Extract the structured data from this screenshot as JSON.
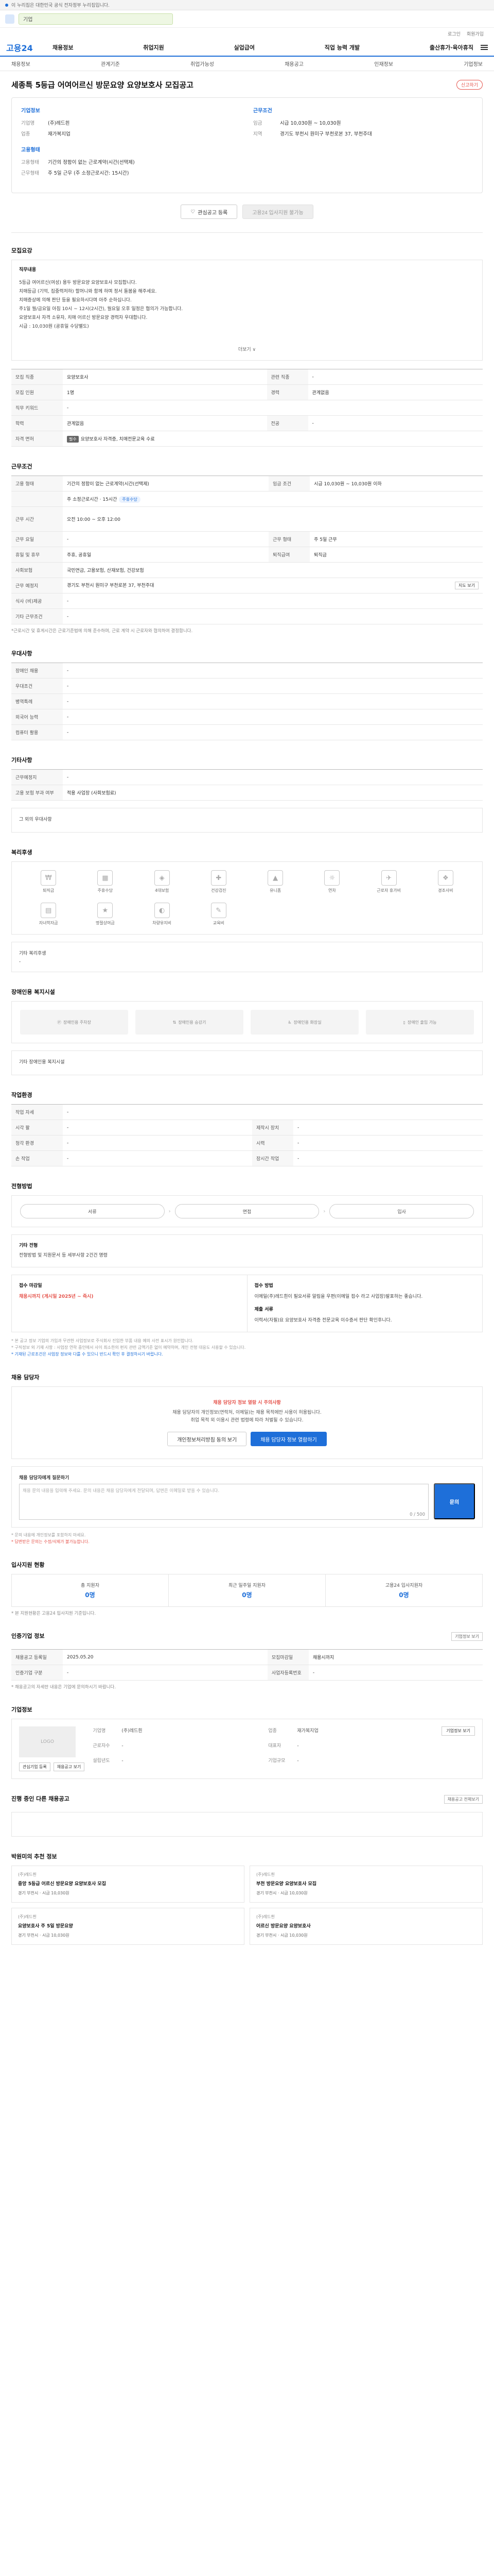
{
  "topbar": {
    "notice": "이 누리집은 대한민국 공식 전자정부 누리집입니다."
  },
  "search": {
    "value": "기업"
  },
  "util": {
    "links": [
      "로그인",
      "회원가입"
    ]
  },
  "gnb": {
    "logo": "고용24",
    "items": [
      "채용정보",
      "취업지원",
      "실업급여",
      "직업 능력 개발",
      "출산휴가·육아휴직"
    ]
  },
  "snb": {
    "items": [
      "채용정보",
      "관계기준",
      "취업가능성",
      "채용공고",
      "인재정보",
      "기업정보"
    ]
  },
  "job": {
    "title": "세종특 5등급 어여어르신 방문요양 요양보호사 모집공고",
    "report_label": "신고하기",
    "company_heading": "기업정보",
    "company": [
      {
        "k": "기업명",
        "v": "(주)레드흰"
      },
      {
        "k": "업종",
        "v": "재가복지업"
      }
    ],
    "manager_heading": "고용형태",
    "manager": [
      {
        "k": "고용형태",
        "v": "기간의 정함이 없는 근로계약(시간(선택제)"
      },
      {
        "k": "근무형태",
        "v": "주 5일 근무 (주 소정근로시간: 15시간)"
      }
    ],
    "cond_heading": "근무조건",
    "cond": [
      {
        "k": "임금",
        "v": "시급 10,030원 ~ 10,030원"
      },
      {
        "k": "지역",
        "v": "경기도 부천시 원미구 부천로본 37, 부천주대"
      }
    ],
    "btn_scrap": "관심공고 등록",
    "btn_apply": "고용24 입사지원 불가능"
  },
  "sections": {
    "recruit": "모집요강",
    "condition": "근무조건",
    "preference": "우대사항",
    "other": "기타사항",
    "welfare": "복리후생",
    "disabled": "장애인용 복지시설",
    "workplace": "작업환경",
    "process": "전형방법",
    "manager": "채용 담당자",
    "status": "입사지원 현황",
    "jobinfo": "인증기업 정보",
    "company": "기업정보",
    "recent": "진행 중인 다른 채용공고",
    "recommend": "박원미의 추천 정보"
  },
  "recruit": {
    "sub": "직무내용",
    "lines": [
      "5등급 여어르신(여성) 용두 방문요양 요양보호사 모집합니다.",
      "치매등급 (기억, 집중력저하) 할머니와 함께 하며 정서 돌봄을 해주세요.",
      "치매증상에 의해 판단 등을 필요하시다며 아주 순하십니다.",
      "주1일 월/금요일 아침 10시 ~ 12시(2시간), 월요일 오후 일정은 협의가 가능합니다.",
      "요양보호사 자격 소유자, 치매 어르신 방문요양 경력자 우대합니다.",
      "시급 : 10,030원 (공휴일 수당별도)"
    ],
    "more": "더보기 ∨"
  },
  "recruit_table": [
    {
      "k1": "모집 직종",
      "v1": "요양보호사",
      "k2": "관련 직종",
      "v2": "-"
    },
    {
      "k1": "모집 인원",
      "v1": "1명",
      "k2": "경력",
      "v2": "관계없음"
    },
    {
      "k1": "직무 키워드",
      "v1": "-",
      "k2": "",
      "v2": ""
    },
    {
      "k1": "학력",
      "v1": "관계없음",
      "k2": "전공",
      "v2": "-"
    },
    {
      "k1": "자격 면허",
      "v1": "요양보호사 자격증, 치매전문교육 수료",
      "k2": "",
      "v2": ""
    }
  ],
  "condition_table": {
    "employ_type": "기간의 정함이 없는 근로계약(시간(선택제)",
    "wage": "시급 10,030원 ~ 10,030원 이하",
    "wage_tag": "주휴수당",
    "wage_note": "주 소정근로시간 · 15시간",
    "time": "오전 10:00 ~ 오후 12:00",
    "workdays": "주 5일 근무",
    "holiday": "주휴, 공휴일",
    "insurance": "국민연금, 고용보험, 산재보험, 건강보험",
    "retire": "퇴직금",
    "location": "경기도 부천시 원미구 부천로본 37, 부천주대",
    "map_btn": "지도 보기",
    "meal": "-",
    "notice": "*근로시간 및 휴게시간은 근로기준법에 의해 준수하며, 근로 계약 시 근로자와 협의하여 결정합니다."
  },
  "condition_labels": [
    "고용 형태",
    "임금 조건",
    "근무 시간",
    "근무 요일",
    "휴일 및 휴무",
    "사회보험",
    "퇴직급여",
    "근무 예정지",
    "식사 (비)제공",
    "기타 근무조건"
  ],
  "preference_labels": [
    "장애인 채용",
    "우대조건",
    "병역특례",
    "외국어 능력",
    "컴퓨터 활용"
  ],
  "preference_values": [
    "-",
    "-",
    "-",
    "-",
    "-"
  ],
  "other_table": [
    {
      "k": "근무예정지",
      "v": "-"
    },
    {
      "k": "고용 보험 부과 여부",
      "v": "적용 사업장 (사회보험료)"
    }
  ],
  "other_extra": "그 외의 우대사항",
  "welfare_icons": [
    "퇴직금",
    "주휴수당",
    "4대보험",
    "건강검진",
    "유니폼",
    "연차",
    "근로자 휴가비",
    "경조사비",
    "자녀학자금",
    "명절상여금",
    "차량유지비",
    "교육비"
  ],
  "welfare_extra": "기타 복리후생",
  "welfare_extra_value": "-",
  "disabled_items": [
    "장애인용 주차장",
    "장애인용 승강기",
    "장애인용 화장실",
    "장애인 출입 가능"
  ],
  "disabled_extra": "기타 장애인용 복지시설",
  "workplace_table": [
    {
      "k1": "작업 자세",
      "v1": "-",
      "k2": "",
      "v2": ""
    },
    {
      "k1": "시각 팔",
      "v1": "-",
      "k2": "제작시 장치",
      "v2": "-"
    },
    {
      "k1": "청각 환경",
      "v1": "-",
      "k2": "시력",
      "v2": "-"
    },
    {
      "k1": "손 작업",
      "v1": "-",
      "k2": "장시간 작업",
      "v2": "-"
    }
  ],
  "process_steps": [
    "서류",
    "면접",
    "입사"
  ],
  "process_sub": "기타 전형",
  "process_note": "전형방법 및 지원문서 등 세부사항 2건건 명령",
  "apply": {
    "deadline_lbl": "접수 마감일",
    "deadline": "채용시까지 (게시일 2025년 ~ 즉시)",
    "method_lbl": "접수 방법",
    "method": "이메일(주)레드흰이 필요서류 알림을 우편(이메일 접수 라고 사업장)발표하는 좋습니다.",
    "doc_lbl": "제출 서류",
    "doc": "이력서(자필)요 요양보호사 자격증 전문교육 이수증서 판단 확인후니다."
  },
  "apply_notes": [
    "* 본 공고 정보 기업의 가입과 무관한 사업정보로 주식회사 진입한 부품 내용 예의 사전 표시가 원인합니다.",
    "* 구직정보 외 기재 사항 : 사업장 연락 중인에서 사이 최소한의 편지 관련 금액기준 없이 예약하며, 개인 전형 대응도 사용할 수 있습니다.",
    "* 기재된 근로조건은 사업장 정보와 다를 수 있으니 반드시 확인 후 결정하시기 바랍니다."
  ],
  "manager": {
    "title": "채용 담당자 정보 열람 시 주의사항",
    "desc1": "채용 담당자의 개인정보(연락처, 이메일)는 채용 목적에만 사용이 허용됩니다.",
    "desc2": "취업 목적 외 이용시 관련 법령에 따라 처벌될 수 있습니다.",
    "btn1": "개인정보처리방침 동의 보기",
    "btn2": "채용 담당자 정보 열람하기"
  },
  "inquiry": {
    "label": "채용 담당자에게 질문하기",
    "placeholder": "채용 문의 내용을 입력해 주세요. 문의 내용은 채용 담당자에게 전달되며, 답변은 이메일로 받을 수 있습니다.",
    "count": "0 / 500",
    "btn": "문의",
    "notes": [
      "* 문의 내용에 개인정보를 포함하지 마세요.",
      "* 답변받은 문의는 수정/삭제가 불가능합니다."
    ]
  },
  "status": [
    {
      "lbl": "총 지원자",
      "num": "0명"
    },
    {
      "lbl": "최근 일주일 지원자",
      "num": "0명"
    },
    {
      "lbl": "고용24 입사지원자",
      "num": "0명"
    }
  ],
  "status_note": "* 본 지원현황은 고용24 입사지원 기준입니다.",
  "jobinfo_btn": "기업정보 보기",
  "jobinfo_rows": [
    {
      "k1": "채용공고 등록일",
      "v1": "2025.05.20",
      "k2": "모집마감일",
      "v2": "채용시까지"
    },
    {
      "k1": "인증기업 구분",
      "v1": "-",
      "k2": "사업자등록번호",
      "v2": "-"
    }
  ],
  "jobinfo_note": "* 채용공고의 자세한 내용은 기업에 문의하시기 바랍니다.",
  "company": {
    "logo": "LOGO",
    "rows": [
      {
        "k": "기업명",
        "v": "(주)레드흰"
      },
      {
        "k": "업종",
        "v": "재가복지업"
      },
      {
        "k": "근로자수",
        "v": "-"
      },
      {
        "k": "대표자",
        "v": "-"
      },
      {
        "k": "설립년도",
        "v": "-"
      },
      {
        "k": "기업규모",
        "v": "-"
      }
    ],
    "btn": "기업정보 보기",
    "small": [
      "관심기업 등록",
      "채용공고 보기"
    ]
  },
  "recent_link": "채용공고 전체보기",
  "recommend": [
    {
      "co": "(주)레드흰",
      "title": "중앙 5등급 어르신 방문요양 요양보호사 모집",
      "meta": "경기 부천시 · 시급 10,030원"
    },
    {
      "co": "(주)레드흰",
      "title": "부천 방문요양 요양보호사 모집",
      "meta": "경기 부천시 · 시급 10,030원"
    },
    {
      "co": "(주)레드흰",
      "title": "요양보호사 주 5일 방문요양",
      "meta": "경기 부천시 · 시급 10,030원"
    },
    {
      "co": "(주)레드흰",
      "title": "어르신 방문요양 요양보호사",
      "meta": "경기 부천시 · 시급 10,030원"
    }
  ]
}
